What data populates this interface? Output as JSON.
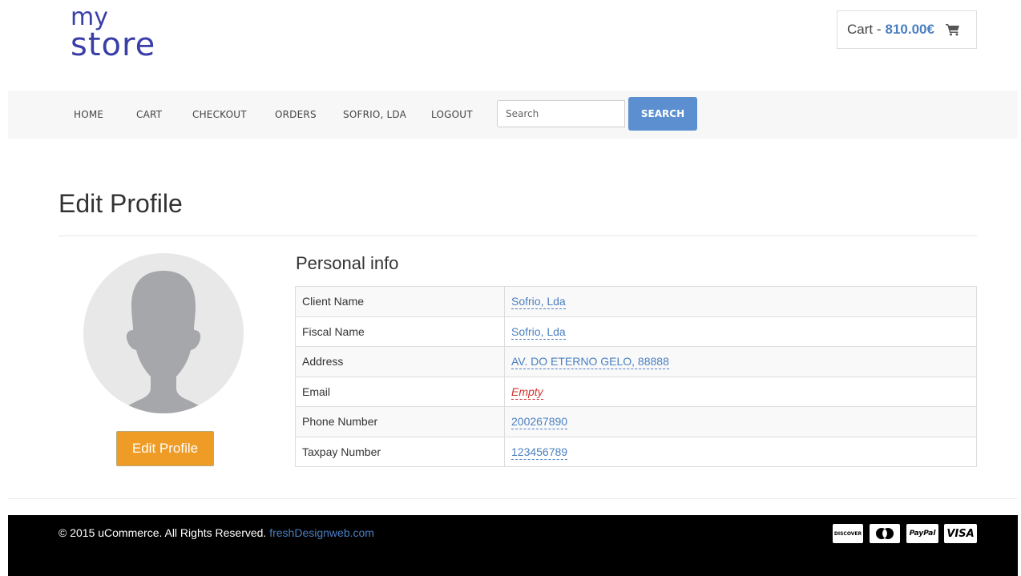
{
  "logo": {
    "line1": "my",
    "line2": "store"
  },
  "cart": {
    "label": "Cart -",
    "amount": "810.00€",
    "icon": "shopping-cart-icon"
  },
  "nav": {
    "items": [
      "HOME",
      "CART",
      "CHECKOUT",
      "ORDERS",
      "SOFRIO, LDA",
      "LOGOUT"
    ],
    "search_placeholder": "Search",
    "search_button": "SEARCH"
  },
  "page": {
    "title": "Edit Profile"
  },
  "profile": {
    "edit_button": "Edit Profile",
    "avatar_icon": "user-silhouette-icon"
  },
  "personal_info": {
    "title": "Personal info",
    "rows": [
      {
        "label": "Client Name",
        "value": "Sofrio, Lda"
      },
      {
        "label": "Fiscal Name",
        "value": "Sofrio, Lda"
      },
      {
        "label": "Address",
        "value": "AV. DO ETERNO GELO, 88888"
      },
      {
        "label": "Email",
        "value": "Empty"
      },
      {
        "label": "Phone Number",
        "value": "200267890"
      },
      {
        "label": "Taxpay Number",
        "value": "123456789"
      }
    ]
  },
  "footer": {
    "copyright": "© 2015 uCommerce. All Rights Reserved.",
    "link": "freshDesignweb.com",
    "payments": [
      "DISCOVER",
      "MasterCard",
      "PayPal",
      "VISA"
    ]
  },
  "colors": {
    "brand": "#3a3fa8",
    "accent": "#5b8fd0",
    "link": "#4a7fc1",
    "button_orange": "#ef9c27",
    "empty_red": "#d2322d"
  }
}
